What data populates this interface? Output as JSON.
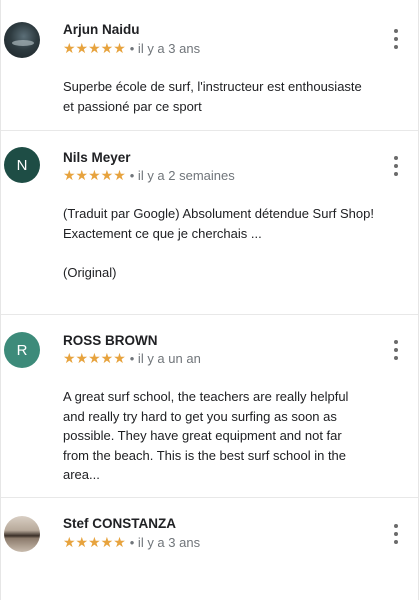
{
  "reviews": [
    {
      "name": "Arjun Naidu",
      "stars": "★★★★★",
      "time": "• il y a 3 ans",
      "text_lines": [
        "Superbe école de surf, l'instructeur est enthousiaste et passioné par ce sport"
      ]
    },
    {
      "name": "Nils Meyer",
      "avatar_letter": "N",
      "avatar_color": "#1e4d45",
      "stars": "★★★★★",
      "time": "• il y a 2 semaines",
      "text_1": "(Traduit par Google) Absolument détendue Surf Shop!",
      "text_2": "Exactement ce que je cherchais ...",
      "text_3": "(Original)"
    },
    {
      "name": "ROSS BROWN",
      "avatar_letter": "R",
      "avatar_color": "#3d8b7a",
      "stars": "★★★★★",
      "time": "• il y a un an",
      "text": "A great surf school, the teachers are really helpful and really try hard to get you surfing as soon as possible. They have great equipment and not far from the beach. This is the best surf school in the area..."
    },
    {
      "name": "Stef CONSTANZA",
      "stars": "★★★★★",
      "time": "• il y a 3 ans"
    }
  ],
  "colors": {
    "star": "#e7a33e",
    "meta_text": "#70757a",
    "divider": "#e8e8e8"
  },
  "icons": {
    "more": "more-vert-icon"
  }
}
